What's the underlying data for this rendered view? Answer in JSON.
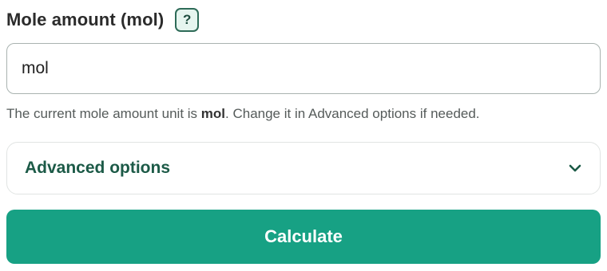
{
  "field": {
    "label": "Mole amount (mol)",
    "help_icon": "question-mark-icon",
    "help_symbol": "?",
    "input_value": "mol"
  },
  "hint": {
    "prefix": "The current mole amount unit is ",
    "unit": "mol",
    "suffix": ". Change it in Advanced options if needed."
  },
  "advanced": {
    "label": "Advanced options",
    "icon": "chevron-down-icon"
  },
  "actions": {
    "calculate_label": "Calculate"
  },
  "colors": {
    "accent": "#17a184",
    "heading_green": "#1c5a47",
    "help_bg": "#e6f5ef"
  }
}
